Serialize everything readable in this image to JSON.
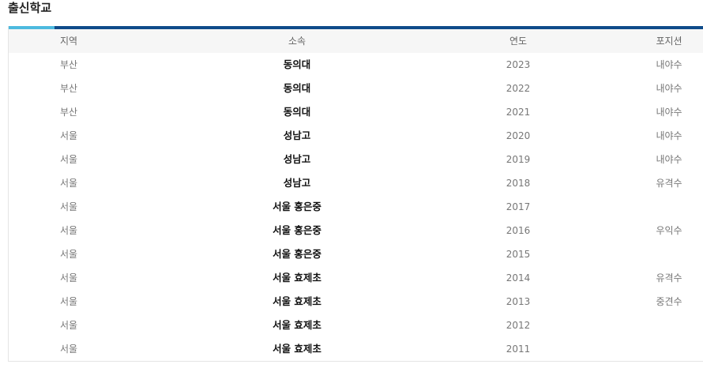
{
  "section_title": "출신학교",
  "columns": {
    "region": "지역",
    "school": "소속",
    "year": "연도",
    "position": "포지션"
  },
  "rows": [
    {
      "region": "부산",
      "school": "동의대",
      "year": "2023",
      "position": "내야수"
    },
    {
      "region": "부산",
      "school": "동의대",
      "year": "2022",
      "position": "내야수"
    },
    {
      "region": "부산",
      "school": "동의대",
      "year": "2021",
      "position": "내야수"
    },
    {
      "region": "서울",
      "school": "성남고",
      "year": "2020",
      "position": "내야수"
    },
    {
      "region": "서울",
      "school": "성남고",
      "year": "2019",
      "position": "내야수"
    },
    {
      "region": "서울",
      "school": "성남고",
      "year": "2018",
      "position": "유격수"
    },
    {
      "region": "서울",
      "school": "서울 홍은중",
      "year": "2017",
      "position": ""
    },
    {
      "region": "서울",
      "school": "서울 홍은중",
      "year": "2016",
      "position": "우익수"
    },
    {
      "region": "서울",
      "school": "서울 홍은중",
      "year": "2015",
      "position": ""
    },
    {
      "region": "서울",
      "school": "서울 효제초",
      "year": "2014",
      "position": "유격수"
    },
    {
      "region": "서울",
      "school": "서울 효제초",
      "year": "2013",
      "position": "중견수"
    },
    {
      "region": "서울",
      "school": "서울 효제초",
      "year": "2012",
      "position": ""
    },
    {
      "region": "서울",
      "school": "서울 효제초",
      "year": "2011",
      "position": ""
    }
  ]
}
